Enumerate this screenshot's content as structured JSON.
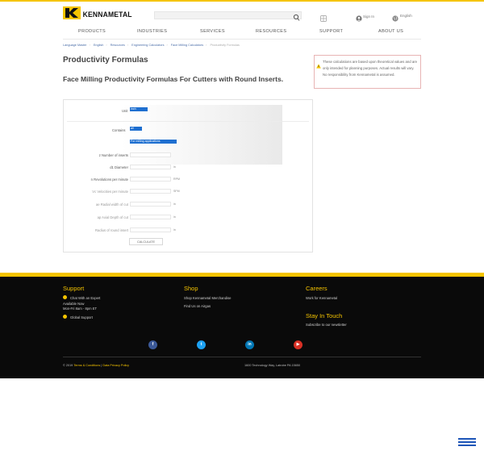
{
  "header": {
    "brand": "KENNAMETAL",
    "search_placeholder": "",
    "sign_in": "Sign In",
    "language": "English"
  },
  "nav": {
    "items": [
      "PRODUCTS",
      "INDUSTRIES",
      "SERVICES",
      "RESOURCES",
      "SUPPORT",
      "ABOUT US"
    ]
  },
  "breadcrumb": [
    "Language Master",
    "English",
    "Resources",
    "Engineering Calculators",
    "Face Milling Calculators",
    "Productivity Formulas"
  ],
  "page": {
    "title": "Productivity Formulas",
    "subtitle": "Face Milling Productivity Formulas For Cutters with Round Inserts."
  },
  "notice": {
    "text": "These calculations are based upon theoretical values and are only intended for planning purposes. Actual results will vary. No responsibility from Kennametal is assumed."
  },
  "calculator": {
    "unit_label": "Unit",
    "unit_value": "inch",
    "contains_label": "Contains",
    "contains_value": "all",
    "contains_option": "For milling applications",
    "fields": [
      {
        "label": "z Number of inserts",
        "unit": "",
        "dim": false
      },
      {
        "label": "d1 Diameter",
        "unit": "in",
        "dim": false
      },
      {
        "label": "n Revolutions per minute",
        "unit": "RPM",
        "dim": false
      },
      {
        "label": "Vc Velocities per minute",
        "unit": "SFM",
        "dim": true
      },
      {
        "label": "ae Radial width of cut",
        "unit": "in",
        "dim": true
      },
      {
        "label": "ap Axial Depth of cut",
        "unit": "in",
        "dim": true
      },
      {
        "label": "Radius of round insert",
        "unit": "in",
        "dim": true
      }
    ],
    "button": "CALCULATE"
  },
  "footer": {
    "support": {
      "title": "Support",
      "chat": "Chat With an Expert",
      "available": "Available Now",
      "hours": "Mon-Fri 8am - 8pm ET",
      "global": "Global Support"
    },
    "shop": {
      "title": "Shop",
      "merch": "Shop Kennametal Merchandise",
      "airgas": "Find Us on Airgas"
    },
    "careers": {
      "title": "Careers",
      "work": "Work for Kennametal"
    },
    "stay": {
      "title": "Stay In Touch",
      "subscribe": "Subscribe to our newsletter"
    },
    "social": [
      "f",
      "t",
      "in",
      "▶"
    ],
    "copyright": "© 2019",
    "terms": "Terms & Conditions",
    "privacy": "Data Privacy Policy",
    "address": "1600 Technology Way, Latrobe PA 15650"
  },
  "colors": {
    "brand": "#f5c400",
    "link": "#4a6da8",
    "select": "#1e6fd0",
    "footer_bg": "#0a0a0a"
  }
}
